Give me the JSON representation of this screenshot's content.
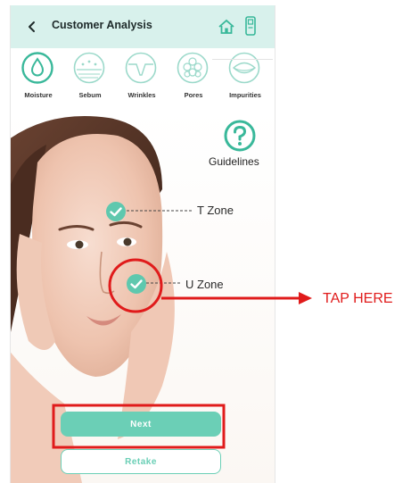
{
  "header": {
    "title": "Customer Analysis"
  },
  "categories": [
    {
      "label": "Moisture",
      "active": true
    },
    {
      "label": "Sebum",
      "active": false
    },
    {
      "label": "Wrinkles",
      "active": false
    },
    {
      "label": "Pores",
      "active": false
    },
    {
      "label": "Impurities",
      "active": false
    }
  ],
  "guidelines": {
    "label": "Guidelines"
  },
  "zones": {
    "t_zone": "T Zone",
    "u_zone": "U Zone"
  },
  "buttons": {
    "next": "Next",
    "retake": "Retake"
  },
  "annotation": {
    "tap_label": "TAP HERE"
  },
  "colors": {
    "accent": "#6bcfb6",
    "header_bg": "#d8f1ec",
    "annotation": "#e01b1b"
  },
  "icons": [
    "chevron-left-icon",
    "home-icon",
    "device-icon",
    "water-drop-icon",
    "sebum-icon",
    "wrinkle-icon",
    "pores-icon",
    "impurities-icon",
    "help-icon",
    "check-icon"
  ]
}
